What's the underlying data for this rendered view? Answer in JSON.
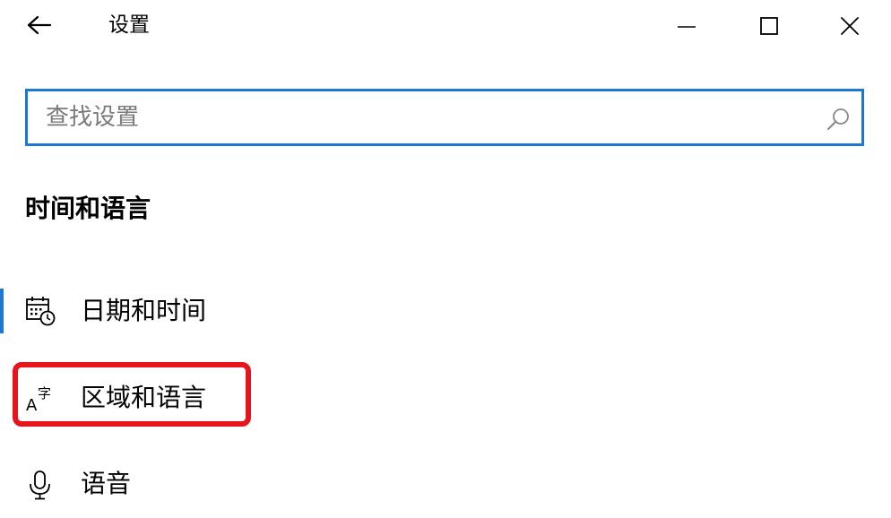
{
  "window": {
    "title": "设置",
    "controls": {
      "back_icon": "arrow-left-icon",
      "minimize_icon": "minimize-icon",
      "maximize_icon": "maximize-icon",
      "close_icon": "close-icon"
    }
  },
  "search": {
    "placeholder": "查找设置",
    "value": "",
    "icon": "search-icon"
  },
  "section": {
    "title": "时间和语言"
  },
  "nav": {
    "items": [
      {
        "label": "日期和时间",
        "icon": "calendar-clock-icon",
        "active": true
      },
      {
        "label": "区域和语言",
        "icon": "language-font-icon",
        "highlighted": true
      },
      {
        "label": "语音",
        "icon": "microphone-icon"
      }
    ]
  },
  "colors": {
    "accent": "#1e78d2",
    "highlight": "#e8141b",
    "placeholder": "#7a7a7a"
  }
}
